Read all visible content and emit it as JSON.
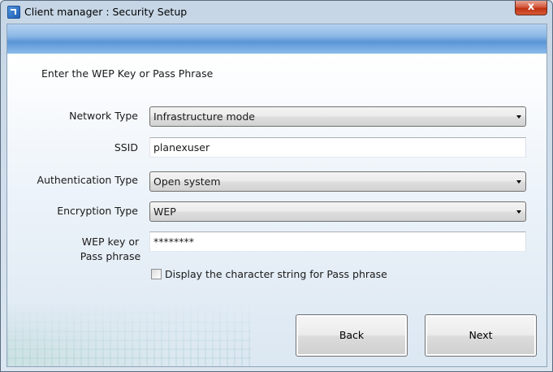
{
  "window": {
    "title": "Client manager : Security Setup",
    "close_glyph": "x"
  },
  "instruction": "Enter the WEP Key or Pass Phrase",
  "form": {
    "network_type": {
      "label": "Network Type",
      "value": "Infrastructure mode"
    },
    "ssid": {
      "label": "SSID",
      "value": "planexuser"
    },
    "authentication_type": {
      "label": "Authentication Type",
      "value": "Open system"
    },
    "encryption_type": {
      "label": "Encryption Type",
      "value": "WEP"
    },
    "wep_key": {
      "label_line1": "WEP key or",
      "label_line2": "Pass phrase",
      "value": "********"
    },
    "display_checkbox": {
      "label": "Display the character string for Pass phrase",
      "checked": false
    }
  },
  "buttons": {
    "back": "Back",
    "next": "Next"
  },
  "icons": {
    "app": "client-manager-icon",
    "dropdown": "chevron-down-icon",
    "close": "close-icon"
  }
}
